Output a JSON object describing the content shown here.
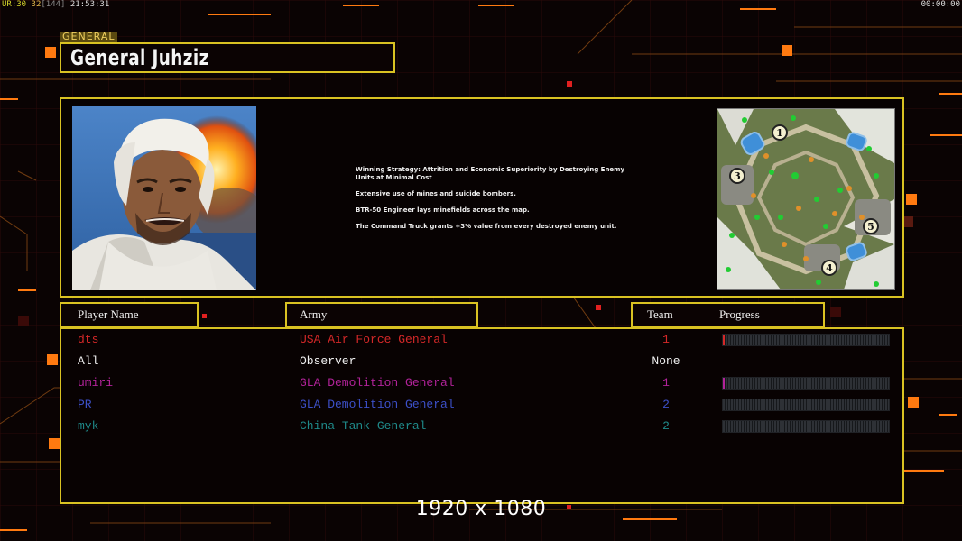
{
  "hud": {
    "ur_label": "UR:",
    "fps": "30",
    "fps2": "32",
    "fps_bracket": "[144]",
    "clock": "21:53:31",
    "timer": "00:00:00"
  },
  "general": {
    "tag": "GENERAL",
    "name": "General Juhziz"
  },
  "strategy": [
    "Winning Strategy: Attrition and Economic Superiority by Destroying Enemy Units at Minimal Cost",
    "Extensive use of mines and suicide bombers.",
    "BTR-50 Engineer lays minefields across the map.",
    "The Command Truck grants +3% value from every destroyed enemy unit."
  ],
  "map": {
    "start_positions": [
      "1",
      "3",
      "5",
      "4"
    ]
  },
  "headers": {
    "player_name": "Player Name",
    "army": "Army",
    "team": "Team",
    "progress": "Progress"
  },
  "players": [
    {
      "name": "dts",
      "army": "USA Air Force General",
      "team": "1",
      "color": "#d42828",
      "progress": 0.01
    },
    {
      "name": "All",
      "army": "Observer",
      "team": "None",
      "color": "#f0f0f0",
      "progress": null
    },
    {
      "name": "umiri",
      "army": "GLA Demolition General",
      "team": "1",
      "color": "#b2239a",
      "progress": 0.01
    },
    {
      "name": "PR",
      "army": "GLA Demolition General",
      "team": "2",
      "color": "#3c50c8",
      "progress": 0
    },
    {
      "name": "myk",
      "army": "China Tank General",
      "team": "2",
      "color": "#1f8a8a",
      "progress": 0
    }
  ],
  "resolution": "1920 x 1080",
  "colors": {
    "accent": "#d9c222",
    "orange": "#ff8a1a"
  }
}
